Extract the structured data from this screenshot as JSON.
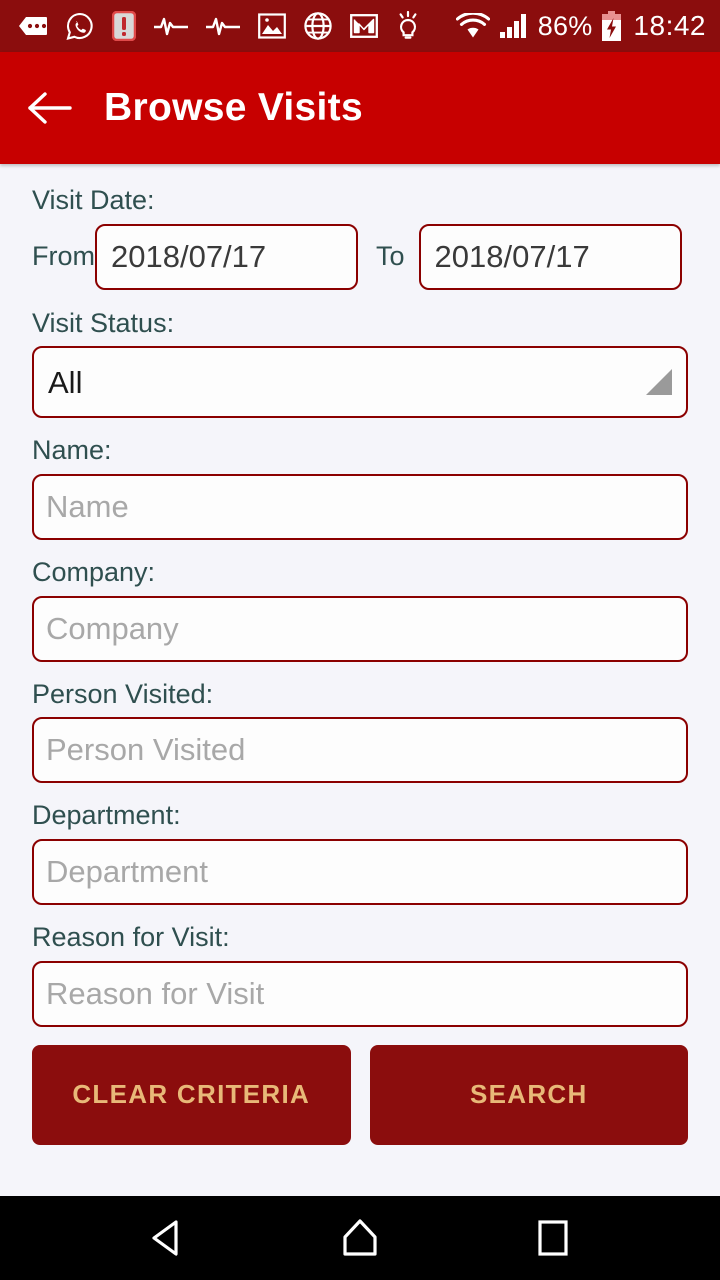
{
  "statusbar": {
    "icons": [
      {
        "name": "sms-icon"
      },
      {
        "name": "whatsapp-icon"
      },
      {
        "name": "alert-icon"
      },
      {
        "name": "pulse-icon"
      },
      {
        "name": "pulse-icon-2"
      },
      {
        "name": "image-icon"
      },
      {
        "name": "globe-icon"
      },
      {
        "name": "gmail-icon"
      },
      {
        "name": "lightbulb-icon"
      }
    ],
    "wifi_icon": "wifi-icon",
    "signal_icon": "cellular-signal-icon",
    "battery_percent": "86%",
    "battery_icon": "battery-charging-icon",
    "clock": "18:42"
  },
  "appbar": {
    "back_icon": "back-arrow-icon",
    "title": "Browse Visits",
    "bg_color": "#C70000"
  },
  "form": {
    "visit_date": {
      "label": "Visit Date:",
      "from_prefix": "From",
      "from_value": "2018/07/17",
      "to_prefix": "To",
      "to_value": "2018/07/17"
    },
    "visit_status": {
      "label": "Visit Status:",
      "selected": "All",
      "dropdown_icon": "spinner-triangle-icon"
    },
    "name": {
      "label": "Name:",
      "value": "",
      "placeholder": "Name"
    },
    "company": {
      "label": "Company:",
      "value": "",
      "placeholder": "Company"
    },
    "person_visited": {
      "label": "Person Visited:",
      "value": "",
      "placeholder": "Person Visited"
    },
    "department": {
      "label": "Department:",
      "value": "",
      "placeholder": "Department"
    },
    "reason_for_visit": {
      "label": "Reason for Visit:",
      "value": "",
      "placeholder": "Reason for Visit"
    }
  },
  "actions": {
    "clear_label": "CLEAR CRITERIA",
    "search_label": "SEARCH",
    "button_bg": "#8B0D0D",
    "button_text_color": "#E8B878"
  },
  "navbar": {
    "back_icon": "nav-back-triangle-icon",
    "home_icon": "nav-home-icon",
    "recents_icon": "nav-recents-square-icon"
  },
  "theme": {
    "page_bg": "#F5F5FA",
    "label_color": "#2F4F4F",
    "field_border": "#8B0000",
    "statusbar_bg": "#8B0D0D"
  }
}
